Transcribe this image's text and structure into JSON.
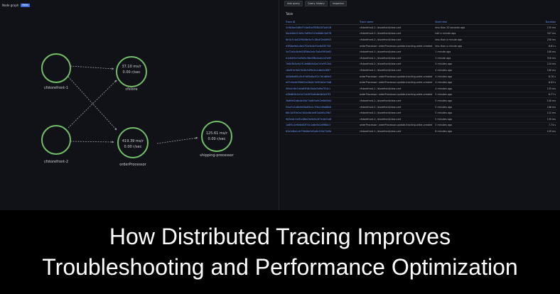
{
  "graph": {
    "header_title": "Node graph",
    "header_tag": "Beta",
    "nodes": [
      {
        "id": "fe1",
        "label": "cfstorefront-1",
        "stat1": "",
        "stat2": ""
      },
      {
        "id": "fe2",
        "label": "cfstorefront-2",
        "stat1": "",
        "stat2": ""
      },
      {
        "id": "store",
        "label": "cfstore",
        "stat1": "37.10 ms/r",
        "stat2": "0.00 r/sec"
      },
      {
        "id": "order",
        "label": "orderProcessor",
        "stat1": "419.39 ms/r",
        "stat2": "0.00 r/sec"
      },
      {
        "id": "ship",
        "label": "shipping-processor",
        "stat1": "125.61 ms/r",
        "stat2": "0.00 r/sec"
      }
    ],
    "colors": {
      "node_ring": "#73bf69",
      "edge": "#9fa2a8",
      "background": "#111217"
    }
  },
  "toolbar": {
    "buttons": [
      {
        "label": "Add query"
      },
      {
        "label": "Query history"
      },
      {
        "label": "Inspector"
      }
    ]
  },
  "table": {
    "title": "Table",
    "columns": [
      "Trace ID",
      "Trace name",
      "Start time",
      "Duration"
    ],
    "rows": [
      {
        "trace_id": "2c9b3ae1d64f7c0a91e3f58b207d4c16",
        "name": "cfstorefront-1: /storefront/view-cart",
        "start": "less than 20 seconds ago",
        "duration": "135 ms"
      },
      {
        "trace_id": "f0a4d6e213b9c7a85e21f4d0b6c3a978",
        "name": "cfstorefront-2: /storefront/view-cart",
        "start": "half a minute ago",
        "duration": "347 ms"
      },
      {
        "trace_id": "8e1b7c4a02f9d36e5a7c18b4f2e0d953",
        "name": "cfstorefront-2: /storefront/view-cart",
        "start": "less than a minute ago",
        "duration": "250 ms"
      },
      {
        "trace_id": "d3f06a9b1c8e47f2a5b0c91e6d3f2748",
        "name": "orderProcessor: orderProcessor-update-tracking-order-created",
        "start": "less than a minute ago",
        "duration": "6.61 s"
      },
      {
        "trace_id": "5a72e0c4b9d18f36a2e4c7b0d5f91e83",
        "name": "cfstorefront-1: /storefront/view-cart",
        "start": "1 minute ago",
        "duration": "100 ms"
      },
      {
        "trace_id": "b1c84f2e7a09d5c36e1f8b4a0c2d7e95",
        "name": "cfstorefront-1: /storefront/view-cart",
        "start": "1 minute ago",
        "duration": "310 ms"
      },
      {
        "trace_id": "7e0d3b5a9c2f14e86b3d0a7c5e9f12b4",
        "name": "cfstorefront-2: /storefront/view-cart",
        "start": "4 minutes ago",
        "duration": "124 ms"
      },
      {
        "trace_id": "c6a9f1e3d07b28c54f9e2b1d6a3c80f7",
        "name": "cfstorefront-1: /storefront/view-cart",
        "start": "4 minutes ago",
        "duration": "100 ms"
      },
      {
        "trace_id": "4d2b8e6f1a3c97d05e8a4f2c7b1d69e3",
        "name": "orderProcessor: orderProcessor-update-tracking-order-created",
        "start": "4 minutes ago",
        "duration": "6.70 s"
      },
      {
        "trace_id": "e97c0a4d3f6b51e28a0c7d9f4b2e13a6",
        "name": "orderProcessor: orderProcessor-update-tracking-order-created",
        "start": "4 minutes ago",
        "duration": "6.93 s"
      },
      {
        "trace_id": "0f5e2c9b7d4a63f18c5b0e3d9a7f24c1",
        "name": "cfstorefront-1: /storefront/view-cart",
        "start": "4 minutes ago",
        "duration": "133 ms"
      },
      {
        "trace_id": "a38d6f0c5e1b72d49f3a8c6e0b5d47f2",
        "name": "orderProcessor: orderProcessor-update-tracking-order-created",
        "start": "5 minutes ago",
        "duration": "6.77 s"
      },
      {
        "trace_id": "3b6f9d2a8c0e45b71d6f3a9c2e8b05d4",
        "name": "cfstorefront-1: /storefront/view-cart",
        "start": "5 minutes ago",
        "duration": "140 ms"
      },
      {
        "trace_id": "f24a7e1c6b9d30a85e2c7f4b1d9a68e0",
        "name": "cfstorefront-2: /storefront/view-cart",
        "start": "5 minutes ago",
        "duration": "106 ms"
      },
      {
        "trace_id": "68c1b3f9e2a7d04c6b1e8f3a0d5c29b7",
        "name": "cfstorefront-1: /storefront/view-cart",
        "start": "5 minutes ago",
        "duration": "112 ms"
      },
      {
        "trace_id": "9d3e0b7a4f1c86e25a9d2c0f7e4b31a8",
        "name": "cfstorefront-2: /storefront/view-cart",
        "start": "5 minutes ago",
        "duration": "135 ms"
      },
      {
        "trace_id": "1a8f5c2e9b6d03f74c1a8e5b2d9f60c3",
        "name": "orderProcessor: orderProcessor-update-tracking-order-created",
        "start": "5 minutes ago",
        "duration": "7.74 s"
      },
      {
        "trace_id": "b5e2d8a1c4f79b06e3d5a8c1f4b72e9d",
        "name": "cfstorefront-1: /storefront/view-cart",
        "start": "6 minutes ago",
        "duration": "129 ms"
      }
    ]
  },
  "banner": {
    "line1": "How Distributed Tracing Improves",
    "line2": "Troubleshooting and Performance Optimization"
  }
}
